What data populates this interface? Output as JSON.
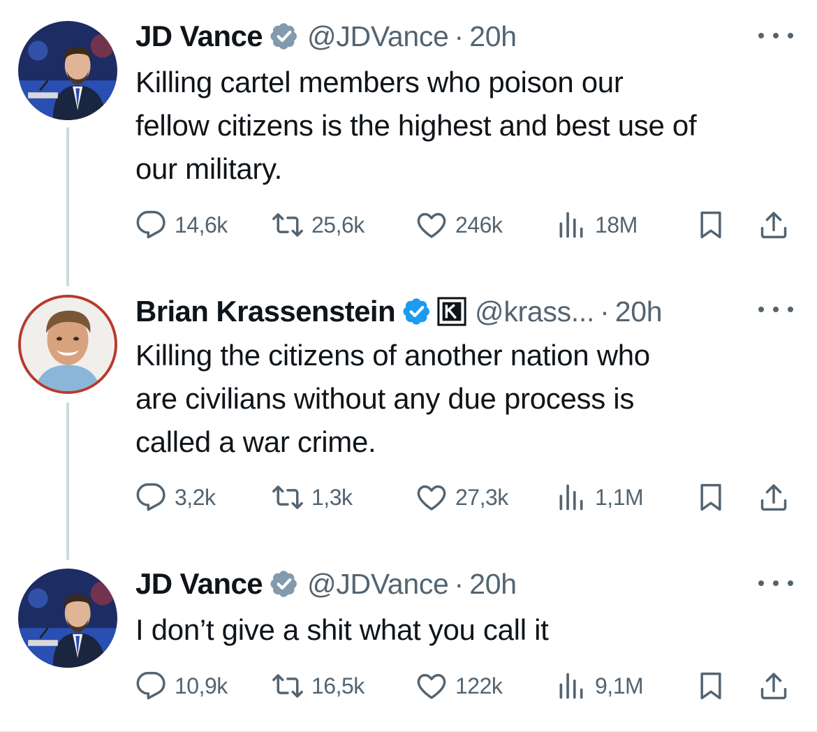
{
  "tweets": [
    {
      "name": "JD Vance",
      "handle": "@JDVance",
      "separator": "·",
      "time": "20h",
      "text_lines": [
        "Killing cartel members who poison our",
        "fellow citizens is the highest and best use of",
        "our military."
      ],
      "badge": "verified-gray-icon",
      "stats": {
        "replies": "14,6k",
        "reposts": "25,6k",
        "likes": "246k",
        "views": "18M"
      }
    },
    {
      "name": "Brian Krassenstein",
      "handle": "@krass...",
      "separator": "·",
      "time": "20h",
      "text_lines": [
        "Killing the citizens of another nation who",
        "are civilians without any due process is",
        "called a war crime."
      ],
      "badge": "verified-blue-icon",
      "affiliate": "k-affiliate-icon",
      "stats": {
        "replies": "3,2k",
        "reposts": "1,3k",
        "likes": "27,3k",
        "views": "1,1M"
      }
    },
    {
      "name": "JD Vance",
      "handle": "@JDVance",
      "separator": "·",
      "time": "20h",
      "text_lines": [
        "I don’t give a shit what you call it"
      ],
      "badge": "verified-gray-icon",
      "stats": {
        "replies": "10,9k",
        "reposts": "16,5k",
        "likes": "122k",
        "views": "9,1M"
      }
    }
  ],
  "colors": {
    "text": "#0f1419",
    "secondary": "#536471",
    "verified_blue": "#1d9bf0",
    "verified_gray": "#829aab",
    "thread_line": "#cfd9de"
  }
}
